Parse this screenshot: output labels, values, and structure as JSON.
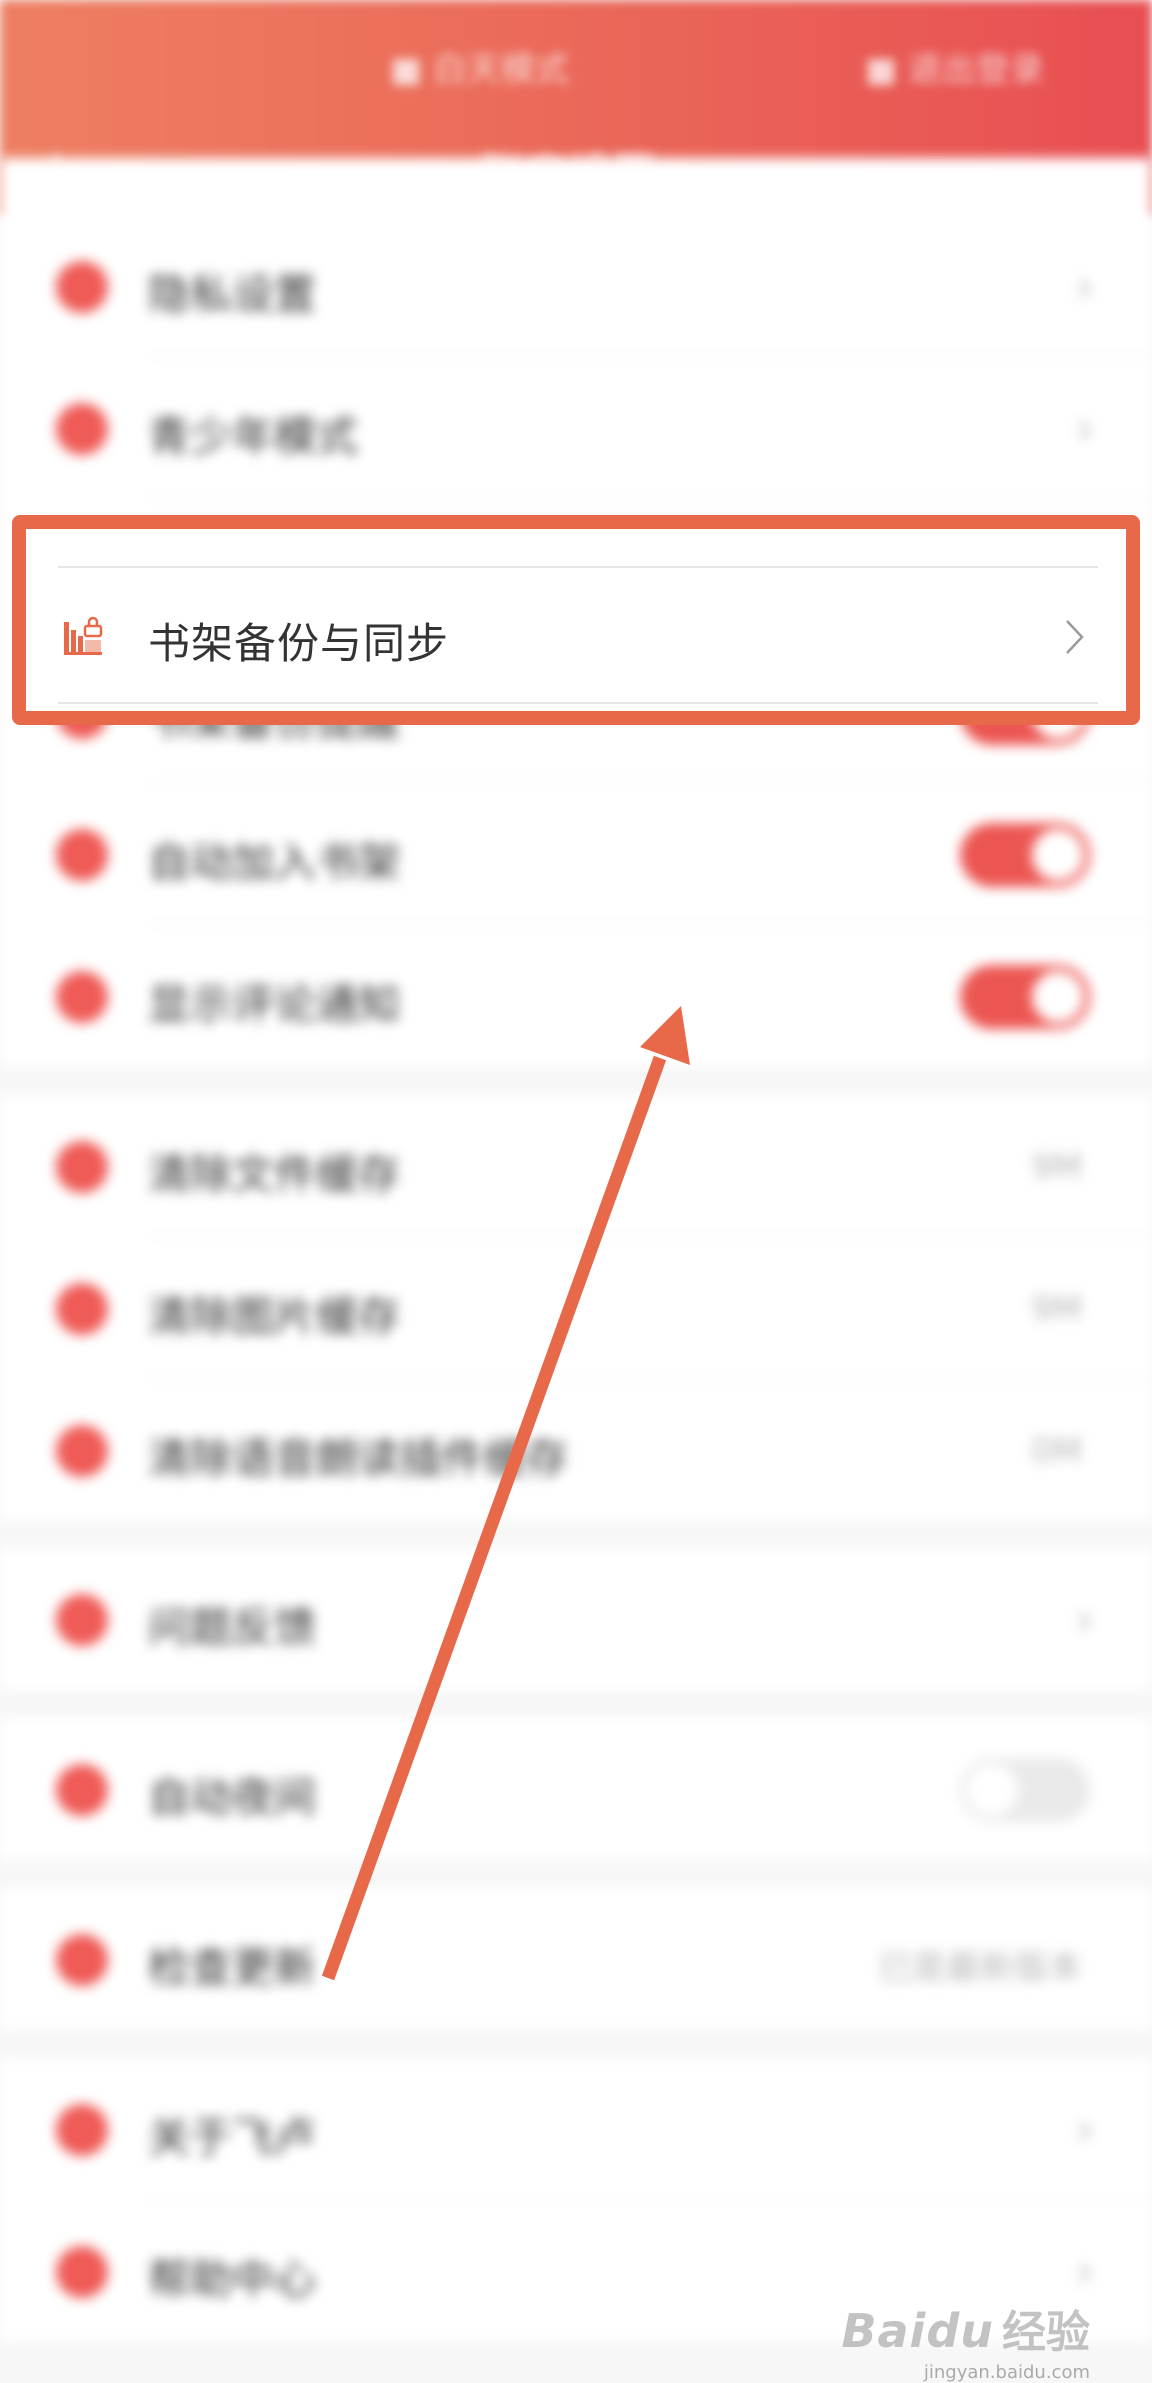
{
  "header": {
    "tab_left": "■ 白天模式",
    "tab_right": "■ 退出登录",
    "back_icon": "‹",
    "title": "账户设置"
  },
  "rows": [
    {
      "label": "隐私设置",
      "right": "chevron",
      "icon": "lock-icon"
    },
    {
      "label": "青少年模式",
      "right": "chevron",
      "icon": "child-icon"
    },
    {
      "label": "书架备份提醒",
      "right": "toggle",
      "on": true,
      "icon": "bookshelf-icon"
    },
    {
      "label": "自动加入书架",
      "right": "toggle",
      "on": true,
      "icon": "add-icon"
    },
    {
      "label": "显示评论通知",
      "right": "toggle",
      "on": true,
      "icon": "comment-icon"
    },
    {
      "label": "清除文件缓存",
      "right": "value",
      "value": "9M",
      "icon": "clean-icon"
    },
    {
      "label": "清除图片缓存",
      "right": "value",
      "value": "9M",
      "icon": "image-icon"
    },
    {
      "label": "清除语音朗读插件缓存",
      "right": "value",
      "value": "0M",
      "icon": "voice-icon"
    },
    {
      "label": "问题反馈",
      "right": "chevron",
      "icon": "feedback-icon"
    },
    {
      "label": "自动夜间",
      "right": "toggle",
      "on": false,
      "icon": "night-icon"
    },
    {
      "label": "检查更新",
      "right": "value",
      "value": "已是最新版本",
      "icon": "update-icon"
    },
    {
      "label": "关于飞卢",
      "right": "chevron",
      "icon": "about-icon"
    },
    {
      "label": "帮助中心",
      "right": "chevron",
      "icon": "help-icon"
    }
  ],
  "highlight": {
    "label": "书架备份与同步",
    "icon": "bookshelf-sync-icon",
    "accent": "#e8694a"
  },
  "watermark": {
    "brand": "Baidu",
    "jy": "经验",
    "url": "jingyan.baidu.com"
  },
  "colors": {
    "header_start": "#ee7f62",
    "header_end": "#e84e52",
    "annotation": "#e8694a",
    "toggle_on": "#ec5652"
  }
}
